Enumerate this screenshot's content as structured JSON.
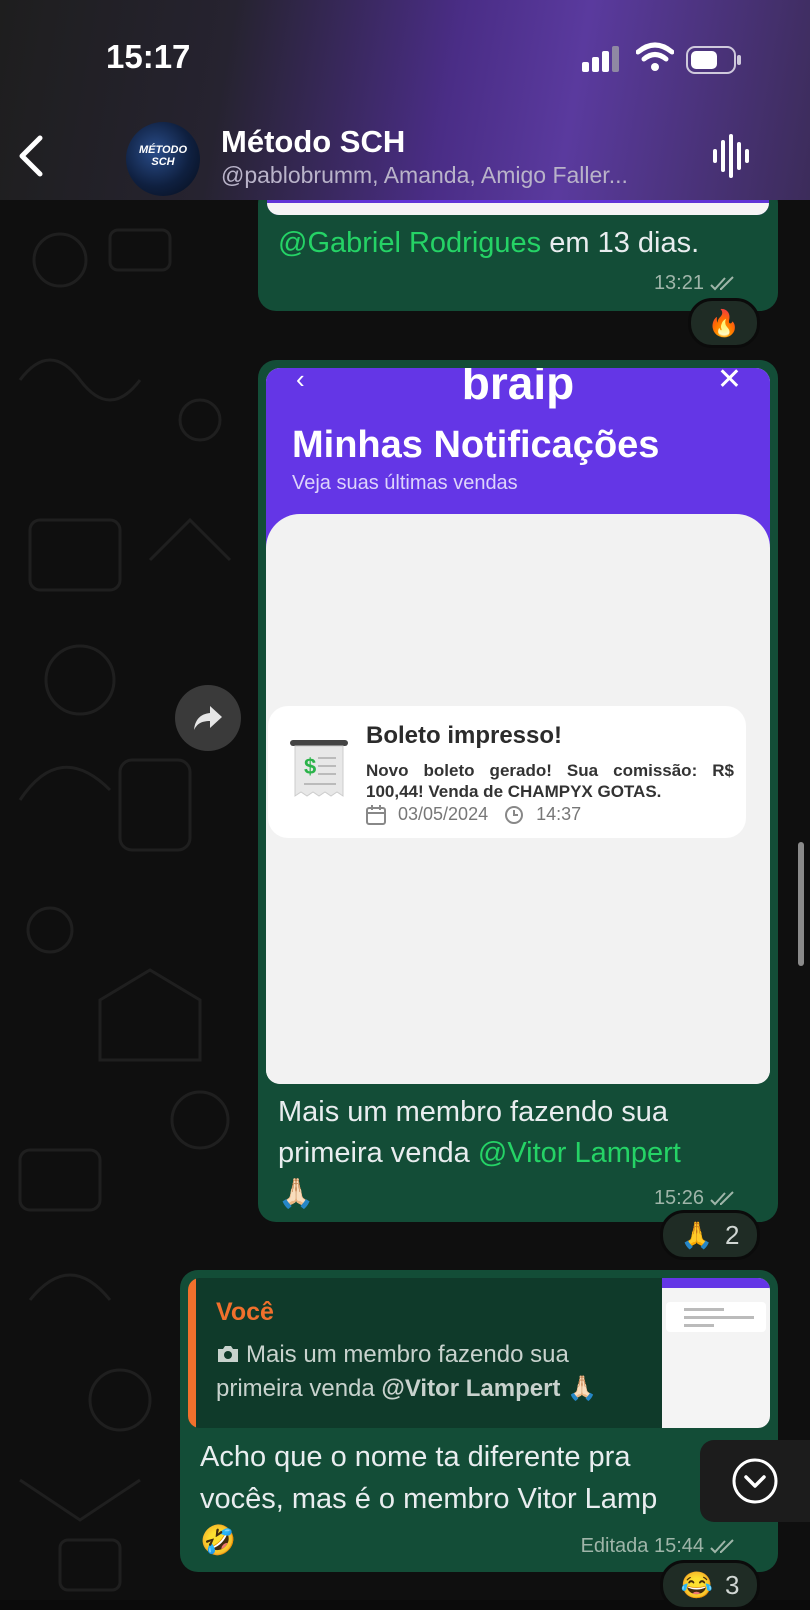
{
  "status_bar": {
    "time": "15:17"
  },
  "header": {
    "title": "Método SCH",
    "subtitle": "@pablobrumm, Amanda, Amigo Faller...",
    "avatar_text": "MÉTODO SCH"
  },
  "messages": [
    {
      "text_mention": "@Gabriel Rodrigues",
      "text_rest": " em 13 dias.",
      "time": "13:21",
      "reaction": "🔥"
    },
    {
      "image": {
        "logo": "braip",
        "title": "Minhas Notificações",
        "subtitle": "Veja suas últimas vendas",
        "card_title": "Boleto impresso!",
        "card_body": "Novo boleto gerado! Sua comissão: R$ 100,44! Venda de CHAMPYX GOTAS.",
        "card_date": "03/05/2024",
        "card_time": "14:37"
      },
      "text_before": "Mais um membro fazendo sua primeira venda ",
      "text_mention": "@Vitor Lampert",
      "emoji": "🙏🏻",
      "time": "15:26",
      "reaction": "🙏",
      "reaction_count": "2"
    },
    {
      "quote_author": "Você",
      "quote_text_before": "Mais um membro fazendo sua primeira venda ",
      "quote_mention": "@Vitor Lampert",
      "quote_emoji": "🙏🏻",
      "text": "Acho que o nome ta diferente pra vocês, mas é o membro Vitor Lamp",
      "emoji": "🤣",
      "time": "Editada 15:44",
      "reaction": "😂",
      "reaction_count": "3"
    }
  ],
  "colors": {
    "bubble": "#134d37",
    "mention": "#25d366",
    "quote_author": "#f0702c",
    "header_accent": "#5a3a9e"
  }
}
